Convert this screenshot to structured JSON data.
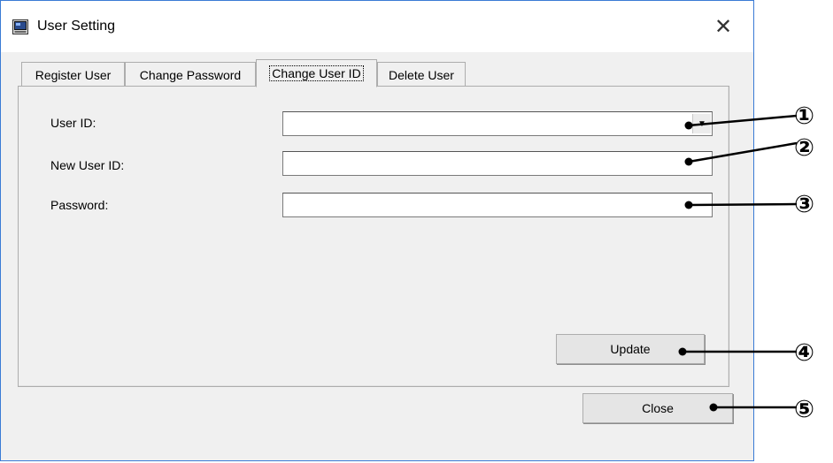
{
  "window": {
    "title": "User Setting"
  },
  "tabs": [
    {
      "label": "Register User"
    },
    {
      "label": "Change Password"
    },
    {
      "label": "Change User ID",
      "active": true
    },
    {
      "label": "Delete User"
    }
  ],
  "form": {
    "user_id_label": "User ID:",
    "user_id_value": "",
    "new_user_id_label": "New User ID:",
    "new_user_id_value": "",
    "password_label": "Password:",
    "password_value": ""
  },
  "buttons": {
    "update": "Update",
    "close": "Close"
  },
  "callouts": [
    "①",
    "②",
    "③",
    "④",
    "⑤"
  ],
  "icons": {
    "app": "window-icon",
    "close": "close-icon",
    "dropdown": "dropdown-arrow-icon"
  }
}
